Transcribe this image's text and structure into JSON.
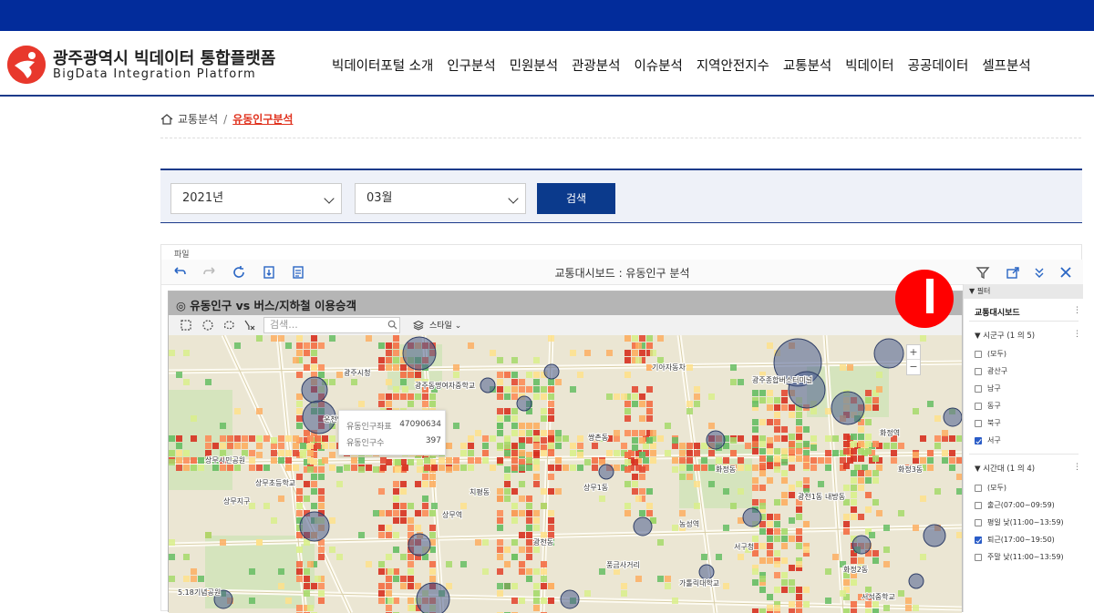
{
  "brand": {
    "title_kr": "광주광역시 빅데이터 통합플랫폼",
    "title_en": "BigData Integration Platform",
    "logo_color": "#e8382c"
  },
  "nav": [
    "빅데이터포털 소개",
    "인구분석",
    "민원분석",
    "관광분석",
    "이슈분석",
    "지역안전지수",
    "교통분석",
    "빅데이터",
    "공공데이터",
    "셀프분석"
  ],
  "breadcrumb": {
    "home_icon": "home-icon",
    "parent": "교통분석",
    "separator": "/",
    "current": "유동인구분석"
  },
  "search": {
    "year": "2021년",
    "month": "03월",
    "button": "검색"
  },
  "dashboard": {
    "menu": "파일",
    "title": "교통대시보드 : 유동인구 분석",
    "panel_title": "◎ 유동인구 vs 버스/지하철 이용승객",
    "map_search_placeholder": "검색...",
    "style_label": "스타일 ⌄",
    "zoom_in": "+",
    "zoom_out": "−",
    "tooltip": {
      "rows": [
        {
          "key": "유동인구좌표",
          "value": "47090634"
        },
        {
          "key": "유동인구수",
          "value": "397"
        }
      ]
    }
  },
  "filter": {
    "header": "▼ 필터",
    "title": "교통대시보드",
    "more": "⋮",
    "groups": [
      {
        "label": "▼ 시군구 (1 의 5)",
        "items": [
          {
            "label": "(모두)",
            "checked": false
          },
          {
            "label": "광산구",
            "checked": false
          },
          {
            "label": "남구",
            "checked": false
          },
          {
            "label": "동구",
            "checked": false
          },
          {
            "label": "북구",
            "checked": false
          },
          {
            "label": "서구",
            "checked": true
          }
        ]
      },
      {
        "label": "▼ 시간대 (1 의 4)",
        "items": [
          {
            "label": "(모두)",
            "checked": false
          },
          {
            "label": "출근(07:00~09:59)",
            "checked": false
          },
          {
            "label": "평일 낮(11:00~13:59)",
            "checked": false
          },
          {
            "label": "퇴근(17:00~19:50)",
            "checked": true
          },
          {
            "label": "주말 낮(11:00~13:59)",
            "checked": false
          }
        ]
      }
    ]
  },
  "colors": {
    "topbar": "#022c9b",
    "primary": "#0b3a8c",
    "highlight": "#e0321e",
    "heat_high": "#d7301f",
    "heat_mid": "#f4a340",
    "heat_low": "#7fc241",
    "bubble": "#4b5d8f",
    "badge": "#ff0000"
  },
  "map_labels": [
    "광주시청",
    "상무시민공원",
    "기아자동차",
    "광주종합버스터미널",
    "화정역",
    "상무역",
    "치평동",
    "화정동",
    "내방동",
    "쌍촌동",
    "운천역",
    "농성역",
    "광천동",
    "서구청",
    "상무초등학교",
    "광주동명여자중학교",
    "광천1동",
    "상무1동",
    "화정2동",
    "화정3동",
    "5.18기념공원",
    "가톨릭대학교",
    "상무지구",
    "서석중학교",
    "풍금사거리"
  ]
}
